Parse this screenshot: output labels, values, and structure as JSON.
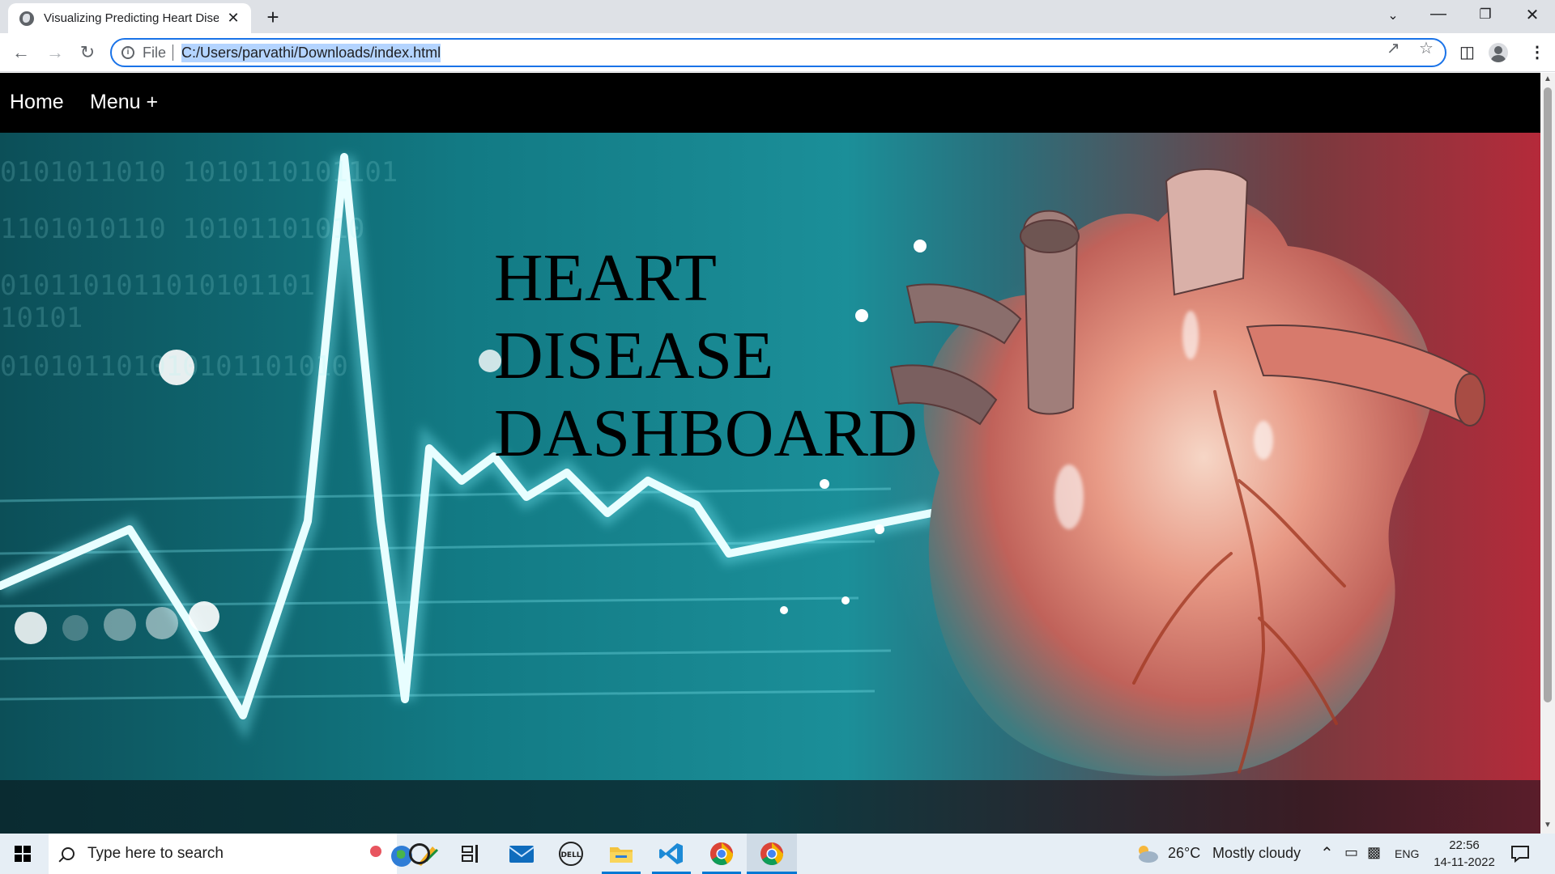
{
  "browser": {
    "tab_title": "Visualizing Predicting Heart Disease",
    "tab_close": "✕",
    "new_tab": "+",
    "scheme_label": "File",
    "url": "C:/Users/parvathi/Downloads/index.html"
  },
  "page": {
    "nav": {
      "home": "Home",
      "menu": "Menu +"
    },
    "hero": {
      "title_lines": [
        "HEART",
        "DISEASE",
        "DASHBOARD"
      ]
    }
  },
  "taskbar": {
    "search_placeholder": "Type here to search",
    "weather": {
      "temperature": "26°C",
      "condition": "Mostly cloudy"
    },
    "language": "ENG",
    "time": "22:56",
    "date": "14-11-2022"
  },
  "colors": {
    "omnibox_focus": "#1a73e8",
    "navbar_bg": "#000000",
    "taskbar_bg": "#e6eef5",
    "taskbar_active": "#0078d4"
  }
}
